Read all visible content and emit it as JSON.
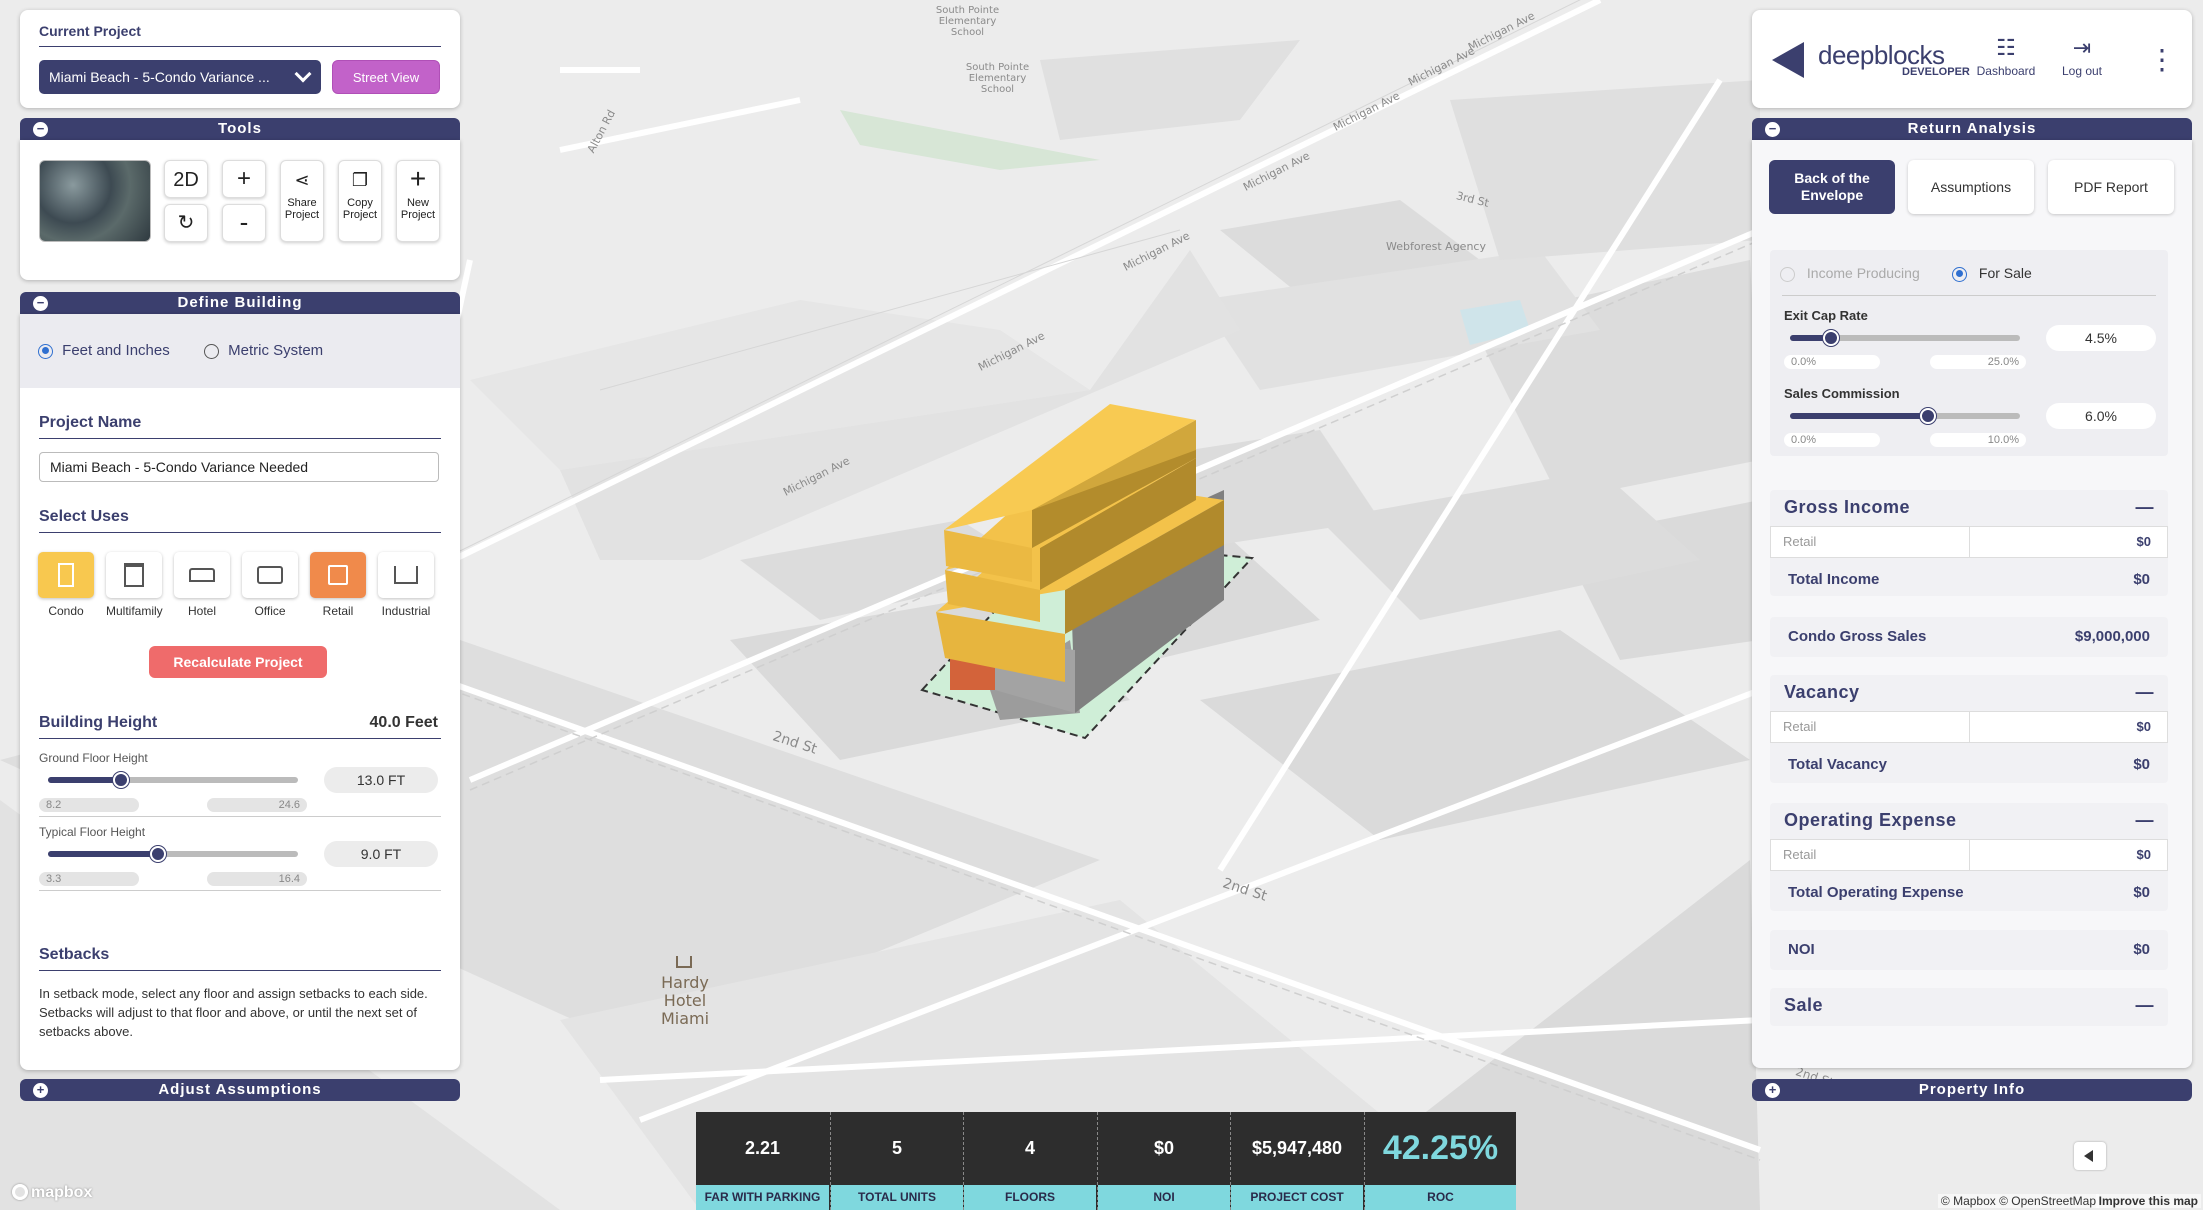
{
  "header": {
    "current_project_label": "Current Project",
    "project_select": "Miami Beach - 5-Condo Variance ...",
    "street_view": "Street View"
  },
  "tools": {
    "title": "Tools",
    "view_mode": "2D",
    "plus": "+",
    "minus": "-",
    "share": "Share Project",
    "copy": "Copy Project",
    "new": "New Project"
  },
  "define": {
    "title": "Define Building",
    "units_imperial": "Feet and Inches",
    "units_metric": "Metric System",
    "project_name_label": "Project Name",
    "project_name_value": "Miami Beach - 5-Condo Variance Needed",
    "select_uses_label": "Select Uses",
    "uses": [
      {
        "label": "Condo",
        "active": true,
        "color": "#f8c84f"
      },
      {
        "label": "Multifamily",
        "active": false
      },
      {
        "label": "Hotel",
        "active": false
      },
      {
        "label": "Office",
        "active": false
      },
      {
        "label": "Retail",
        "active": true,
        "color": "#f08a4b"
      },
      {
        "label": "Industrial",
        "active": false
      }
    ],
    "recalculate": "Recalculate Project",
    "building_height_label": "Building Height",
    "building_height_value": "40.0 Feet",
    "ground": {
      "label": "Ground Floor Height",
      "min": "8.2",
      "max": "24.6",
      "value": "13.0 FT",
      "fraction": 0.29
    },
    "typical": {
      "label": "Typical Floor Height",
      "min": "3.3",
      "max": "16.4",
      "value": "9.0 FT",
      "fraction": 0.44
    },
    "setbacks_label": "Setbacks",
    "setbacks_text": "In setback mode, select any floor and assign setbacks to each side. Setbacks will adjust to that floor and above, or until the next set of setbacks above."
  },
  "adjust": {
    "title": "Adjust Assumptions"
  },
  "brand": {
    "name": "deepblocks",
    "sub": "DEVELOPER",
    "dashboard": "Dashboard",
    "logout": "Log out"
  },
  "return": {
    "title": "Return Analysis",
    "tabs": [
      "Back of the Envelope",
      "Assumptions",
      "PDF Report"
    ],
    "mode_income": "Income Producing",
    "mode_sale": "For Sale",
    "exit_cap": {
      "label": "Exit Cap Rate",
      "min": "0.0%",
      "max": "25.0%",
      "value": "4.5%",
      "fraction": 0.18
    },
    "commission": {
      "label": "Sales Commission",
      "min": "0.0%",
      "max": "10.0%",
      "value": "6.0%",
      "fraction": 0.6
    },
    "gross_income": "Gross Income",
    "gi_retail_label": "Retail",
    "gi_retail_value": "$0",
    "total_income_label": "Total Income",
    "total_income_value": "$0",
    "condo_sales_label": "Condo Gross Sales",
    "condo_sales_value": "$9,000,000",
    "vacancy": "Vacancy",
    "vac_retail_label": "Retail",
    "vac_retail_value": "$0",
    "total_vacancy_label": "Total Vacancy",
    "total_vacancy_value": "$0",
    "opex": "Operating Expense",
    "op_retail_label": "Retail",
    "op_retail_value": "$0",
    "total_opex_label": "Total Operating Expense",
    "total_opex_value": "$0",
    "noi_label": "NOI",
    "noi_value": "$0",
    "sale": "Sale",
    "collapse": "—"
  },
  "property": {
    "title": "Property Info"
  },
  "stats": [
    {
      "v": "2.21",
      "k": "FAR WITH PARKING"
    },
    {
      "v": "5",
      "k": "TOTAL UNITS"
    },
    {
      "v": "4",
      "k": "FLOORS"
    },
    {
      "v": "$0",
      "k": "NOI"
    },
    {
      "v": "$5,947,480",
      "k": "PROJECT COST"
    },
    {
      "v": "42.25%",
      "k": "ROC"
    }
  ],
  "map": {
    "labels": [
      "South Pointe Elementary School",
      "South Pointe Elementary School",
      "Webforest Agency",
      "Hardy Hotel Miami",
      "Michigan Ave",
      "Michigan Ave",
      "Michigan Ave",
      "Michigan Ave",
      "Michigan Ave",
      "Michigan Ave",
      "Michigan Ave",
      "3rd St",
      "2nd St",
      "2nd St",
      "Alton Rd",
      "2nd St"
    ],
    "attribution": "© Mapbox © OpenStreetMap",
    "improve": "Improve this map",
    "logo": "mapbox"
  }
}
